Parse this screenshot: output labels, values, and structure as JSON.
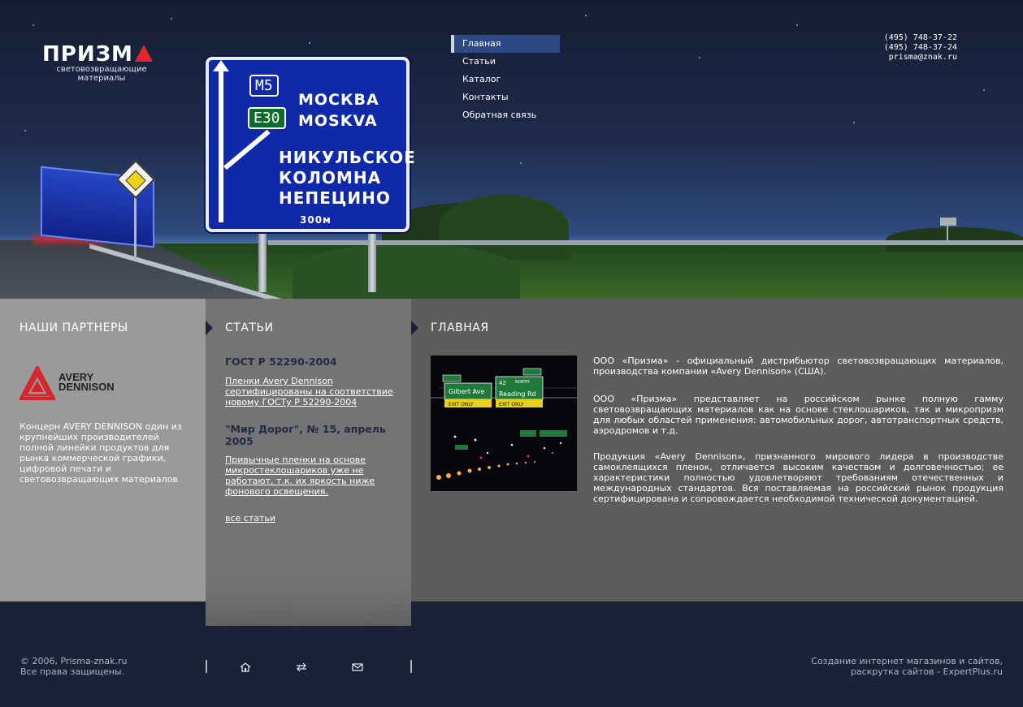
{
  "header": {
    "logo_text": "ПРИЗМ",
    "logo_subtitle_line1": "световозвращающие",
    "logo_subtitle_line2": "материалы",
    "contacts": {
      "phone1": "(495) 748-37-22",
      "phone2": "(495) 748-37-24",
      "email": "prisma@znak.ru"
    },
    "road_sign": {
      "route1": "M5",
      "route2": "E30",
      "city1_ru": "МОСКВА",
      "city1_en": "MOSKVA",
      "dest1": "НИКУЛЬСКОЕ",
      "dest2": "КОЛОМНА",
      "dest3": "НЕПЕЦИНО",
      "distance": "300м"
    }
  },
  "nav": {
    "items": [
      {
        "label": "Главная",
        "active": true
      },
      {
        "label": "Статьи",
        "active": false
      },
      {
        "label": "Каталог",
        "active": false
      },
      {
        "label": "Контакты",
        "active": false
      },
      {
        "label": "Обратная связь",
        "active": false
      }
    ]
  },
  "partners": {
    "title": "НАШИ ПАРТНЕРЫ",
    "logo_line1": "AVERY",
    "logo_line2": "DENNISON",
    "description": "Концерн AVERY DENNISON один из крупнейших производителей полной линейки продуктов для рынка коммерческой графики, цифровой печати и световозвращающих материалов"
  },
  "articles": {
    "title": "СТАТЬИ",
    "items": [
      {
        "heading": "ГОСТ Р 52290-2004",
        "link": "Пленки Avery Dennison сертифицированы на соответствие новому ГОСТу Р 52290-2004"
      },
      {
        "heading": "\"Мир Дорог\", № 15, апрель 2005",
        "link": "Привычные пленки на основе микростеклошариков уже не работают, т.к. их яркость ниже фонового освещения."
      }
    ],
    "all_link": "все статьи"
  },
  "main": {
    "title": "ГЛАВНАЯ",
    "photo_signs": {
      "sign1": "Gilbert Ave",
      "sign2": "Reading Rd",
      "exit_only": "EXIT ONLY",
      "route_num": "42",
      "north": "NORTH"
    },
    "paragraphs": [
      "ООО «Призма» - официальный дистрибьютор световозвращающих материалов, производства компании «Avery Dennison» (США).",
      "ООО «Призма» представляет на российском рынке полную гамму световозвращающих материалов как на основе стеклошариков, так и микропризм для любых областей применения: автомобильных дорог, автотранспортных средств, аэродромов и т.д.",
      "Продукция «Avery Dennison», признанного мирового лидера в производстве самоклеящихся пленок, отличается высоким качеством и долговечностью; ее характеристики полностью удовлетворяют требованиям отечественных и международных стандартов. Вся поставляемая на российский рынок продукция сертифицирована и сопровождается необходимой технической документацией."
    ]
  },
  "footer": {
    "copyright_line1": "© 2006, Prisma-znak.ru",
    "copyright_line2": "Все права защищены.",
    "credits_line1": "Создание интернет магазинов и сайтов,",
    "credits_line2": "раскрутка сайтов - ExpertPlus.ru",
    "icons": [
      "home-icon",
      "sitemap-icon",
      "mail-icon"
    ]
  },
  "colors": {
    "footer_bg": "#1b2238",
    "nav_active": "#2d4a86",
    "logo_triangle": "#e3262a",
    "article_heading": "#222a44"
  }
}
